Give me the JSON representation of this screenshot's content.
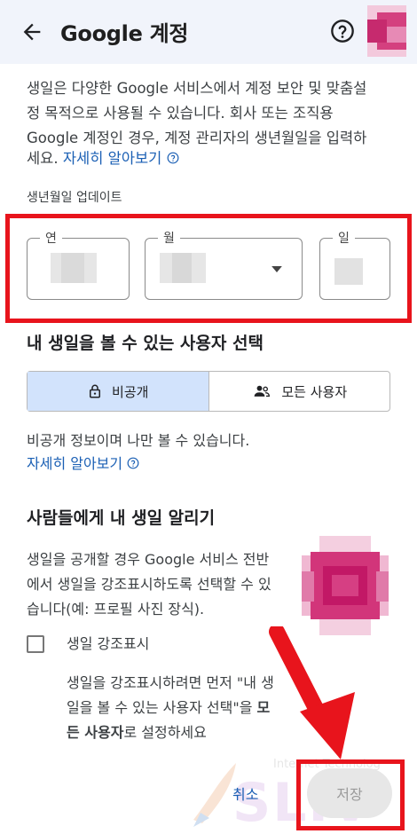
{
  "header": {
    "title": "Google 계정",
    "back_icon": "arrow-back-icon",
    "help_icon": "help-circle-icon"
  },
  "intro": {
    "line1": "생일은 다양한 Google 서비스에서 계정 보안 및 맞춤설",
    "line2": "정 목적으로 사용될 수 있습니다. 회사 또는 조직용",
    "line3": "Google 계정인 경우, 계정 관리자의 생년월일을 입력하",
    "line4_prefix": "세요. ",
    "learn_more": "자세히 알아보기"
  },
  "birthday_update": {
    "label": "생년월일 업데이트",
    "year_label": "연",
    "month_label": "월",
    "day_label": "일"
  },
  "visibility": {
    "heading": "내 생일을 볼 수 있는 사용자 선택",
    "private_label": "비공개",
    "everyone_label": "모든 사용자",
    "note": "비공개 정보이며 나만 볼 수 있습니다.",
    "learn_more": "자세히 알아보기"
  },
  "announce": {
    "heading": "사람들에게 내 생일 알리기",
    "desc1": "생일을 공개할 경우 Google 서비스 전반",
    "desc2": "에서 생일을 강조표시하도록 선택할 수 있",
    "desc3": "습니다(예: 프로필 사진 장식).",
    "checkbox_label": "생일 강조표시",
    "hint1": "생일을 강조표시하려면 먼저 \"내 생",
    "hint2": "일을 볼 수 있는 사용자 선택\"을 ",
    "hint2_bold": "모",
    "hint3_bold": "든 사용자",
    "hint3": "로 설정하세요"
  },
  "footer": {
    "cancel_label": "취소",
    "save_label": "저장"
  },
  "watermark": {
    "text": "SLIV",
    "subtext": "Internet Technolog"
  },
  "colors": {
    "accent": "#1a5fb4",
    "highlight_red": "#e8141c",
    "selected_segment": "#d2e3fc"
  }
}
